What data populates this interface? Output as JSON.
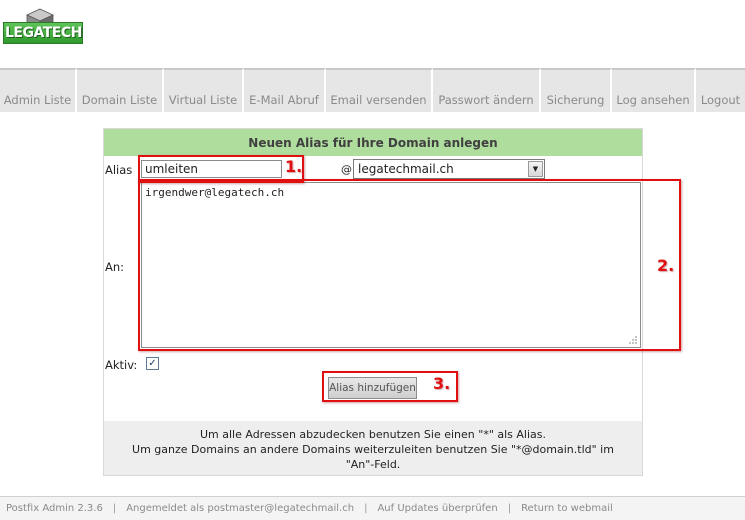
{
  "logo": {
    "text": "LEGATECH"
  },
  "nav": {
    "items": [
      {
        "label": "Admin Liste",
        "w": 77
      },
      {
        "label": "Domain Liste",
        "w": 87
      },
      {
        "label": "Virtual Liste",
        "w": 80
      },
      {
        "label": "E-Mail Abruf",
        "w": 82
      },
      {
        "label": "Email versenden",
        "w": 107
      },
      {
        "label": "Passwort ändern",
        "w": 108
      },
      {
        "label": "Sicherung",
        "w": 71
      },
      {
        "label": "Log ansehen",
        "w": 84
      },
      {
        "label": "Logout",
        "w": 49
      }
    ]
  },
  "form": {
    "title": "Neuen Alias für Ihre Domain anlegen",
    "alias_label": "Alias",
    "alias_value": "umleiten",
    "at_sign": "@",
    "domain_value": "legatechmail.ch",
    "to_label": "An:",
    "to_value": "irgendwer@legatech.ch",
    "active_label": "Aktiv:",
    "active_checked": true,
    "submit_label": "Alias hinzufügen",
    "help_line1": "Um alle Adressen abzudecken benutzen Sie einen \"*\" als Alias.",
    "help_line2": "Um ganze Domains an andere Domains weiterzuleiten benutzen Sie \"*@domain.tld\" im",
    "help_line3": "\"An\"-Feld."
  },
  "annotations": {
    "one": "1.",
    "two": "2.",
    "three": "3.",
    "color": "#e01010"
  },
  "footer": {
    "version": "Postfix Admin 2.3.6",
    "sep": "|",
    "logged_in": "Angemeldet als postmaster@legatechmail.ch",
    "updates": "Auf Updates überprüfen",
    "webmail": "Return to webmail"
  }
}
